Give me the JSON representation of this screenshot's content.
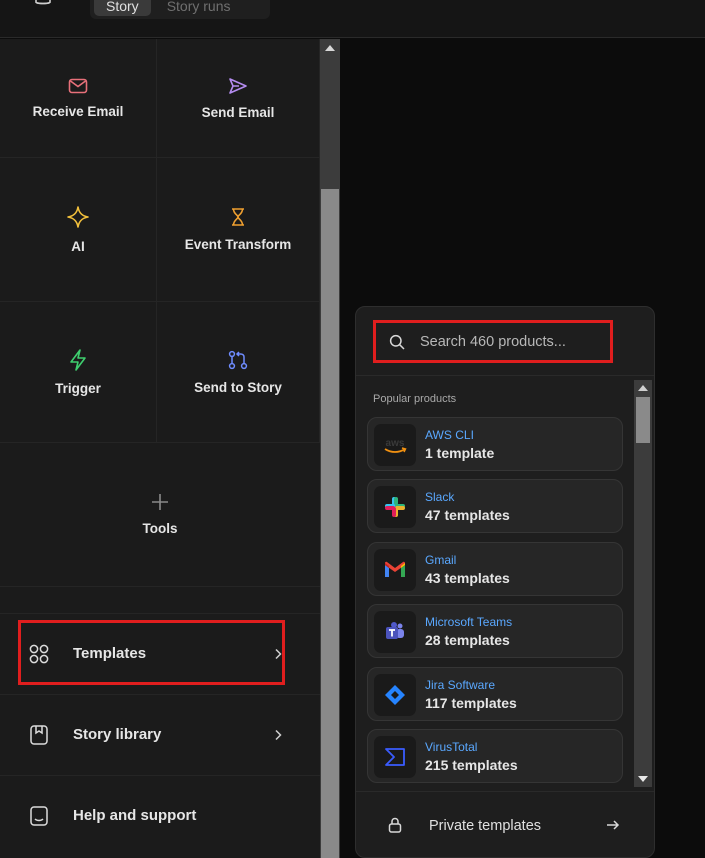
{
  "header": {
    "tabs": [
      {
        "label": "Story",
        "active": true
      },
      {
        "label": "Story runs",
        "active": false
      }
    ]
  },
  "actions": {
    "receive_email": "Receive Email",
    "send_email": "Send Email",
    "ai": "AI",
    "event_transform": "Event Transform",
    "trigger": "Trigger",
    "send_to_story": "Send to Story",
    "tools": "Tools"
  },
  "menu": {
    "templates": "Templates",
    "story_library": "Story library",
    "help": "Help and support"
  },
  "popover": {
    "search_placeholder": "Search 460 products...",
    "heading": "Popular products",
    "products": [
      {
        "name": "AWS CLI",
        "count": "1 template",
        "icon": "aws-icon"
      },
      {
        "name": "Slack",
        "count": "47 templates",
        "icon": "slack-icon"
      },
      {
        "name": "Gmail",
        "count": "43 templates",
        "icon": "gmail-icon"
      },
      {
        "name": "Microsoft Teams",
        "count": "28 templates",
        "icon": "teams-icon"
      },
      {
        "name": "Jira Software",
        "count": "117 templates",
        "icon": "jira-icon"
      },
      {
        "name": "VirusTotal",
        "count": "215 templates",
        "icon": "virustotal-icon"
      }
    ],
    "private_label": "Private templates"
  },
  "colors": {
    "accent_link": "#5aa8ff",
    "highlight": "#e01e1e",
    "email_icon": "#e8707a",
    "send_icon": "#b48cf0",
    "ai_icon": "#f2c03c",
    "transform_icon": "#f0a030",
    "trigger_icon": "#3ecf6e",
    "send_story_icon": "#6f8cff"
  }
}
